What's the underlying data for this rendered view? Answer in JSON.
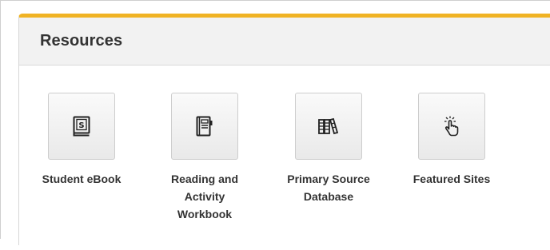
{
  "panel": {
    "title": "Resources",
    "accent_color": "#f0b324"
  },
  "resources": [
    {
      "label": "Student eBook",
      "icon": "ebook-icon",
      "icon_letter": "S"
    },
    {
      "label": "Reading and Activity Workbook",
      "icon": "workbook-icon"
    },
    {
      "label": "Primary Source Database",
      "icon": "books-icon"
    },
    {
      "label": "Featured Sites",
      "icon": "tap-hand-icon"
    }
  ]
}
